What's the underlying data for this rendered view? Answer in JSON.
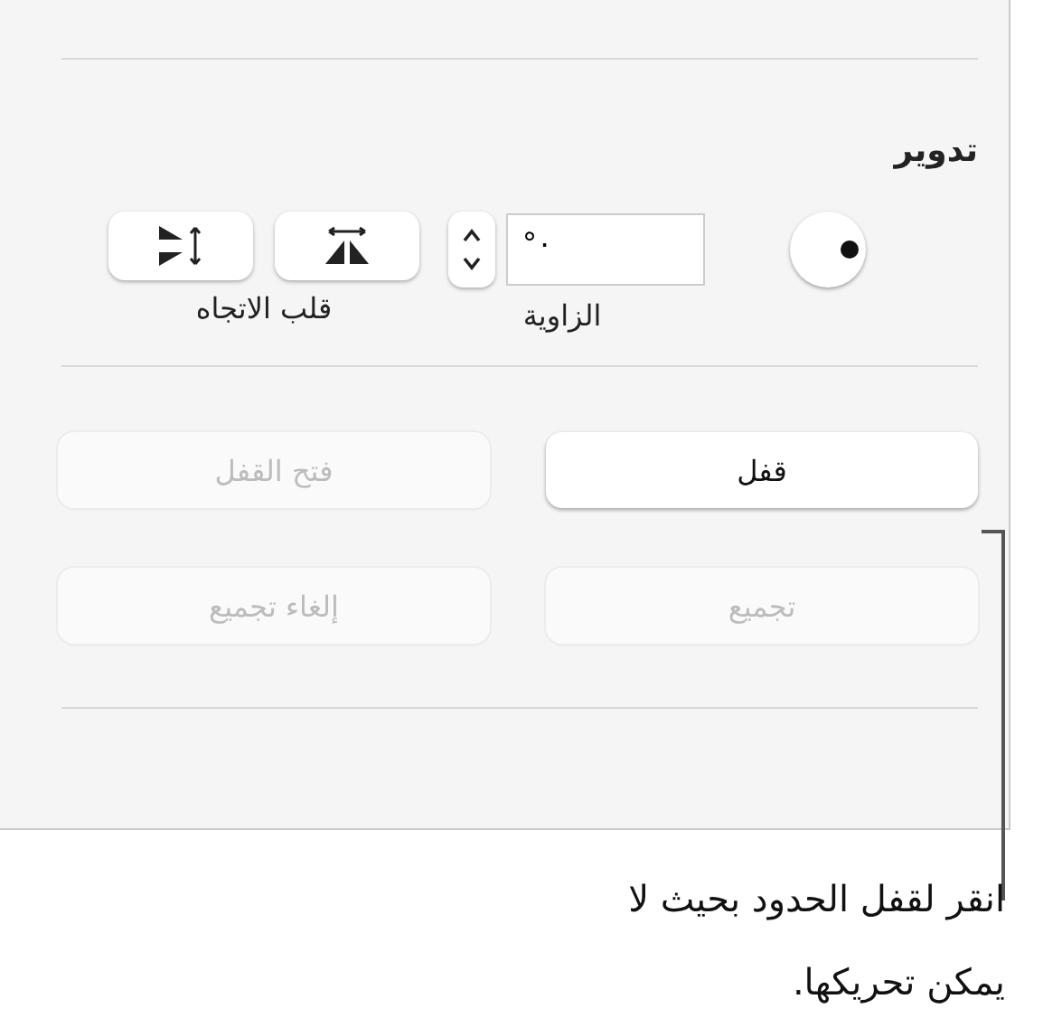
{
  "rotate": {
    "heading": "تدوير",
    "angle": {
      "value": "٠°",
      "label": "الزاوية"
    },
    "flip": {
      "label": "قلب الاتجاه",
      "buttons": [
        {
          "kind": "horizontal"
        },
        {
          "kind": "vertical"
        }
      ]
    }
  },
  "arrange_buttons": [
    {
      "label": "قفل",
      "disabled": false
    },
    {
      "label": "فتح القفل",
      "disabled": true
    },
    {
      "label": "تجميع",
      "disabled": true
    },
    {
      "label": "إلغاء تجميع",
      "disabled": true
    }
  ],
  "callout": "انقر لقفل الحدود بحيث لا يمكن تحريكها."
}
